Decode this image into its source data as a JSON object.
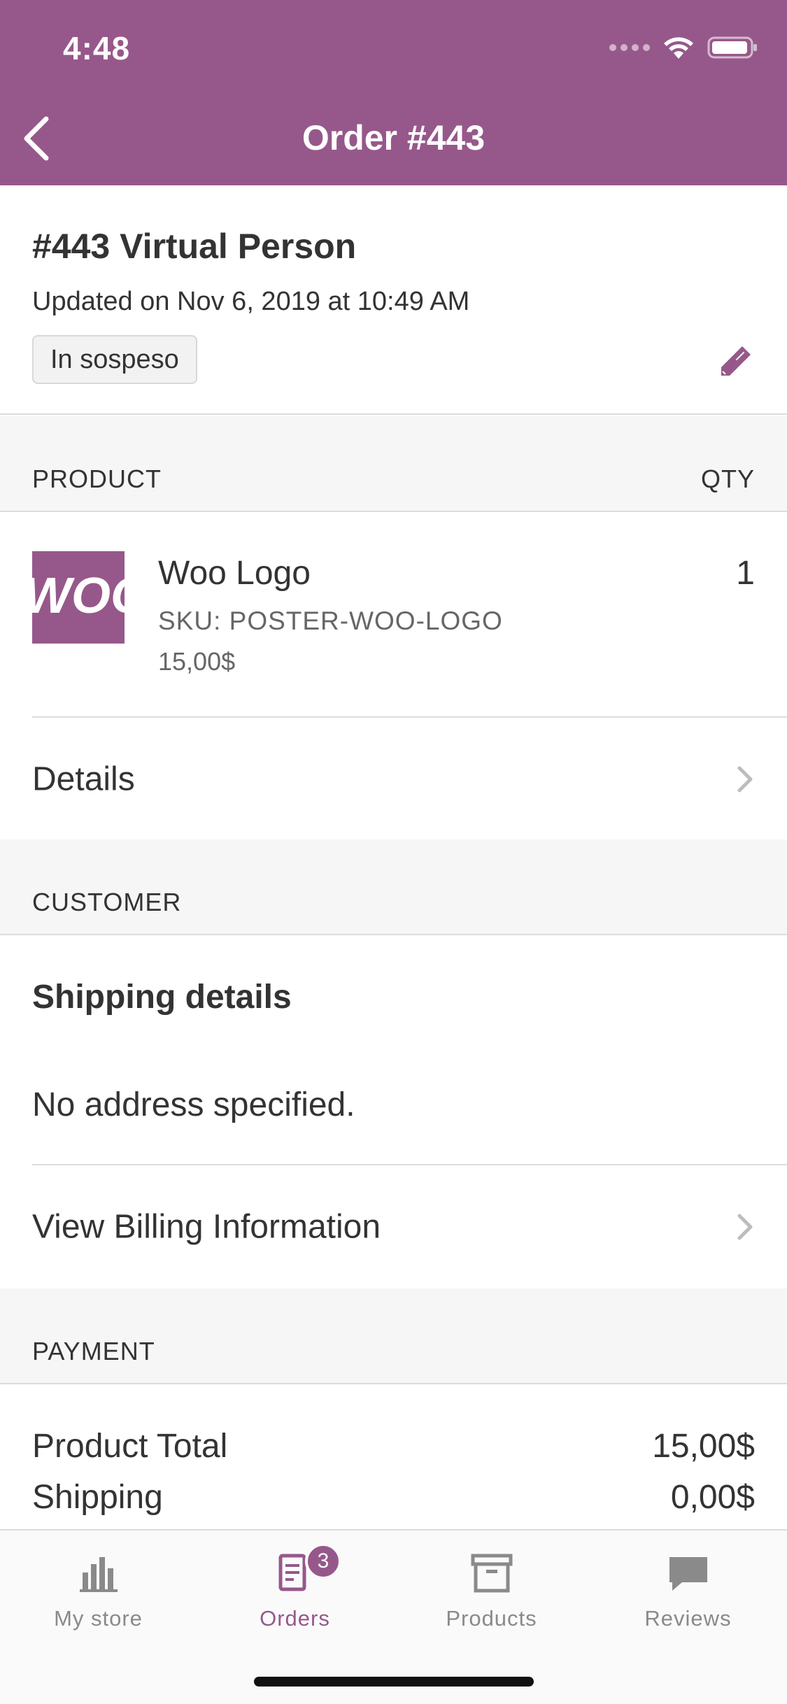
{
  "status_bar": {
    "time": "4:48"
  },
  "nav": {
    "title": "Order #443"
  },
  "order": {
    "name": "#443 Virtual Person",
    "updated": "Updated on Nov 6, 2019 at 10:49 AM",
    "status": "In sospeso"
  },
  "product_section": {
    "header": "PRODUCT",
    "qty_header": "QTY"
  },
  "product": {
    "name": "Woo Logo",
    "sku": "SKU: POSTER-WOO-LOGO",
    "price": "15,00$",
    "qty": "1",
    "thumb_text": "WOO"
  },
  "details_row": {
    "label": "Details"
  },
  "customer_section": {
    "header": "CUSTOMER"
  },
  "customer": {
    "shipping_title": "Shipping details",
    "no_address": "No address specified.",
    "billing_label": "View Billing Information"
  },
  "payment_section": {
    "header": "PAYMENT"
  },
  "payment": {
    "rows": [
      {
        "label": "Product Total",
        "value": "15,00$"
      },
      {
        "label": "Shipping",
        "value": "0,00$"
      }
    ]
  },
  "tabs": [
    {
      "label": "My store",
      "icon": "bar-chart-icon",
      "active": false
    },
    {
      "label": "Orders",
      "icon": "orders-icon",
      "active": true,
      "badge": "3"
    },
    {
      "label": "Products",
      "icon": "archive-box-icon",
      "active": false
    },
    {
      "label": "Reviews",
      "icon": "speech-bubble-icon",
      "active": false
    }
  ],
  "colors": {
    "accent": "#96588a",
    "section_bg": "#f6f6f6",
    "divider": "#dcdcdc"
  }
}
